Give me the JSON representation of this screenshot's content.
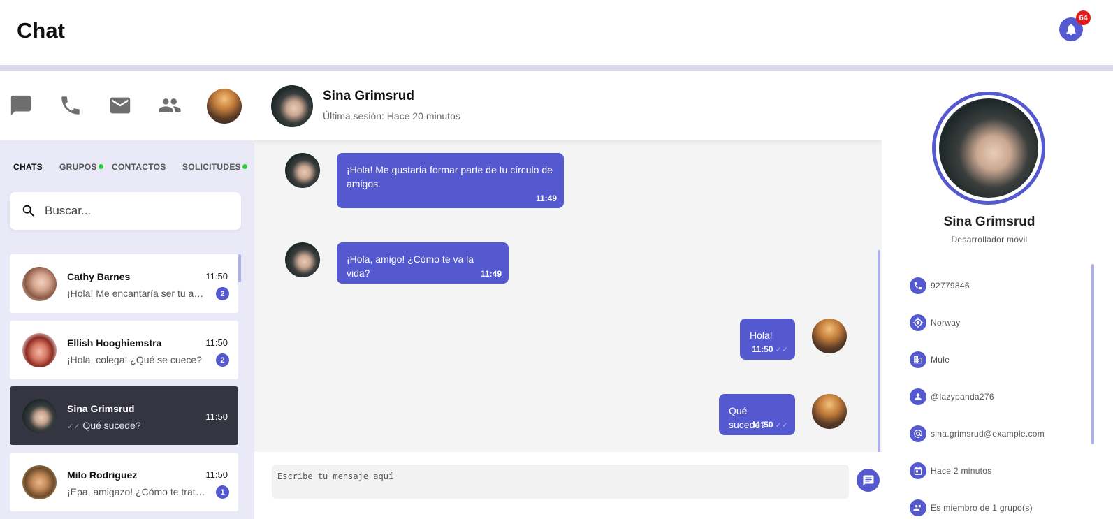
{
  "app": {
    "title": "Chat",
    "notifications_count": "64"
  },
  "colors": {
    "accent": "#5459cf",
    "badge_red": "#e61b1b",
    "online_green": "#2ecc40",
    "active_item_bg": "#343541"
  },
  "nav_icons": [
    "chat-icon",
    "phone-icon",
    "mail-icon",
    "people-icon"
  ],
  "tabs": [
    {
      "label": "CHATS",
      "active": true,
      "dot": false
    },
    {
      "label": "GRUPOS",
      "active": false,
      "dot": true
    },
    {
      "label": "CONTACTOS",
      "active": false,
      "dot": false
    },
    {
      "label": "SOLICITUDES",
      "active": false,
      "dot": true
    }
  ],
  "search": {
    "placeholder": "Buscar..."
  },
  "chats": [
    {
      "name": "Cathy Barnes",
      "time": "11:50",
      "preview": "¡Hola! Me encantaría ser tu amiga",
      "unread": "2"
    },
    {
      "name": "Ellish Hooghiemstra",
      "time": "11:50",
      "preview": "¡Hola, colega! ¿Qué se cuece?",
      "unread": "2"
    },
    {
      "name": "Sina Grimsrud",
      "time": "11:50",
      "preview": "Qué sucede?",
      "unread": ""
    },
    {
      "name": "Milo Rodriguez",
      "time": "11:50",
      "preview": "¡Epa, amigazo! ¿Cómo te trata la vida?",
      "unread": "1"
    }
  ],
  "conversation": {
    "name": "Sina Grimsrud",
    "status": "Última sesión: Hace 20 minutos",
    "messages": [
      {
        "from": "them",
        "text": "¡Hola! Me gustaría formar parte de tu círculo de amigos.",
        "time": "11:49"
      },
      {
        "from": "them",
        "text": "¡Hola, amigo! ¿Cómo te va la vida?",
        "time": "11:49"
      },
      {
        "from": "me",
        "text": "Hola!",
        "time": "11:50",
        "ticks": "✓✓"
      },
      {
        "from": "me",
        "text": "Qué sucede?",
        "time": "11:50",
        "ticks": "✓✓"
      }
    ]
  },
  "composer": {
    "placeholder": "Escribe tu mensaje aquí"
  },
  "profile": {
    "name": "Sina Grimsrud",
    "role": "Desarrollador móvil",
    "info": [
      {
        "icon": "phone-icon",
        "text": "92779846"
      },
      {
        "icon": "location-icon",
        "text": "Norway"
      },
      {
        "icon": "company-icon",
        "text": "Mule"
      },
      {
        "icon": "user-icon",
        "text": "@lazypanda276"
      },
      {
        "icon": "at-icon",
        "text": "sina.grimsrud@example.com"
      },
      {
        "icon": "calendar-icon",
        "text": "Hace 2 minutos"
      },
      {
        "icon": "group-icon",
        "text": "Es miembro de 1 grupo(s)"
      }
    ]
  }
}
